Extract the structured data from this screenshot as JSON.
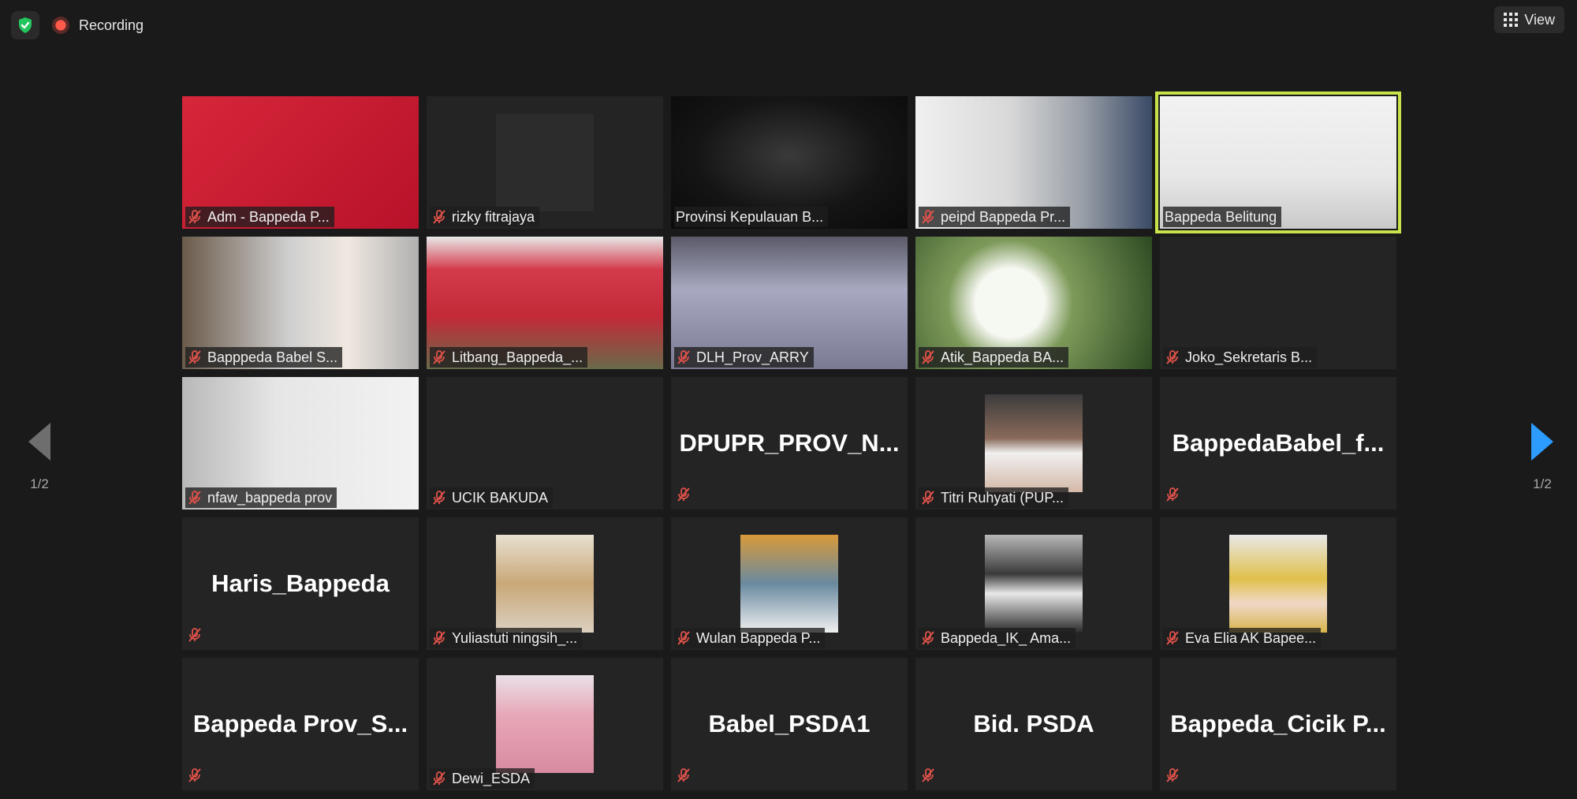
{
  "topbar": {
    "recording_label": "Recording",
    "view_label": "View"
  },
  "pager": {
    "left_page": "1/2",
    "right_page": "1/2"
  },
  "tiles": [
    {
      "label": "Adm - Bappeda P...",
      "muted": true,
      "kind": "video",
      "scene": "poster"
    },
    {
      "label": "rizky fitrajaya",
      "muted": true,
      "kind": "photo",
      "scene": "logo"
    },
    {
      "label": "Provinsi Kepulauan B...",
      "muted": false,
      "kind": "video",
      "scene": "dark"
    },
    {
      "label": "peipd Bappeda Pr...",
      "muted": true,
      "kind": "video",
      "scene": "blur"
    },
    {
      "label": "Bappeda Belitung",
      "muted": false,
      "kind": "video",
      "scene": "room",
      "active": true
    },
    {
      "label": "Bapppeda Babel S...",
      "muted": true,
      "kind": "video",
      "scene": "kitchen"
    },
    {
      "label": "Litbang_Bappeda_...",
      "muted": true,
      "kind": "video",
      "scene": "bappeda"
    },
    {
      "label": "DLH_Prov_ARRY",
      "muted": true,
      "kind": "video",
      "scene": "window"
    },
    {
      "label": "Atik_Bappeda BA...",
      "muted": true,
      "kind": "video",
      "scene": "flower"
    },
    {
      "label": "Joko_Sekretaris B...",
      "muted": true,
      "kind": "blank"
    },
    {
      "label": "nfaw_bappeda prov",
      "muted": true,
      "kind": "video",
      "scene": "wall"
    },
    {
      "label": "UCIK BAKUDA",
      "muted": true,
      "kind": "blank"
    },
    {
      "big_name": "DPUPR_PROV_N...",
      "muted": true,
      "kind": "name"
    },
    {
      "label": "Titri Ruhyati (PUP...",
      "muted": true,
      "kind": "photo",
      "scene": "face1"
    },
    {
      "big_name": "BappedaBabel_f...",
      "muted": true,
      "kind": "name"
    },
    {
      "big_name": "Haris_Bappeda",
      "muted": true,
      "kind": "name"
    },
    {
      "label": "Yuliastuti ningsih_...",
      "muted": true,
      "kind": "photo",
      "scene": "face2"
    },
    {
      "label": "Wulan Bappeda P...",
      "muted": true,
      "kind": "photo",
      "scene": "face3"
    },
    {
      "label": "Bappeda_IK_ Ama...",
      "muted": true,
      "kind": "photo",
      "scene": "face4"
    },
    {
      "label": "Eva Elia AK Bapee...",
      "muted": true,
      "kind": "photo",
      "scene": "face5"
    },
    {
      "big_name": "Bappeda  Prov_S...",
      "muted": true,
      "kind": "name"
    },
    {
      "label": "Dewi_ESDA",
      "muted": true,
      "kind": "photo",
      "scene": "face6"
    },
    {
      "big_name": "Babel_PSDA1",
      "muted": true,
      "kind": "name"
    },
    {
      "big_name": "Bid. PSDA",
      "muted": true,
      "kind": "name"
    },
    {
      "big_name": "Bappeda_Cicik  P...",
      "muted": true,
      "kind": "name"
    }
  ],
  "icons": {
    "security": "shield-check-icon",
    "record": "record-dot-icon",
    "view": "grid-view-icon",
    "muted": "mic-muted-icon",
    "prev": "prev-page-icon",
    "next": "next-page-icon"
  },
  "colors": {
    "background": "#1a1a1a",
    "tile": "#242424",
    "active_speaker": "#c7e34b",
    "security_green": "#23c55e",
    "record_red": "#ff5a4a",
    "muted_red": "#e0524a",
    "next_arrow": "#2d9cff"
  }
}
